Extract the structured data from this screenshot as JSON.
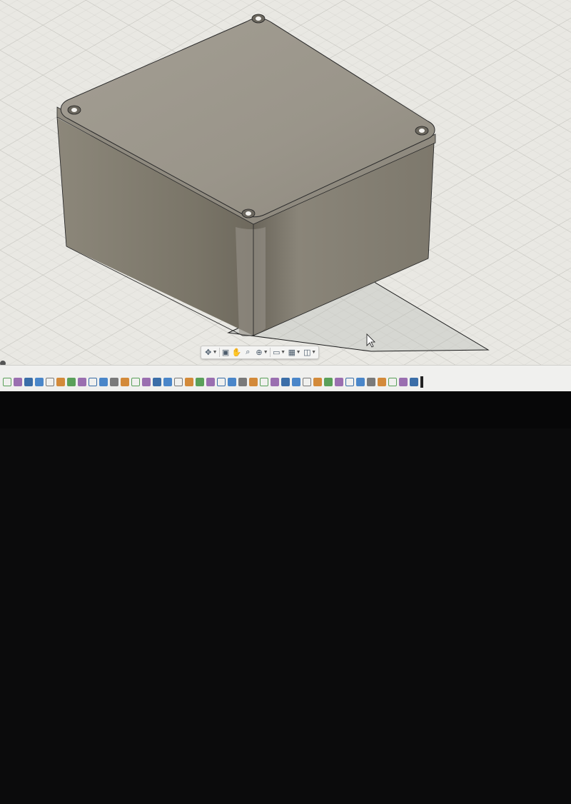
{
  "colors": {
    "grid_background": "#e9e8e3",
    "model_top": "#9c978c",
    "model_side": "#7b7669",
    "timeline_bar": "#f0f0ee",
    "bezel": "#070708"
  },
  "navigation_bar": {
    "items": [
      {
        "icon": "orbit-icon"
      },
      {
        "icon": "look-at-icon"
      },
      {
        "icon": "pan-icon"
      },
      {
        "icon": "zoom-icon"
      },
      {
        "icon": "fit-icon"
      },
      {
        "icon": "display-settings-icon"
      },
      {
        "icon": "grid-settings-icon"
      },
      {
        "icon": "viewports-icon"
      }
    ]
  },
  "timeline": {
    "feature_count": 39
  }
}
